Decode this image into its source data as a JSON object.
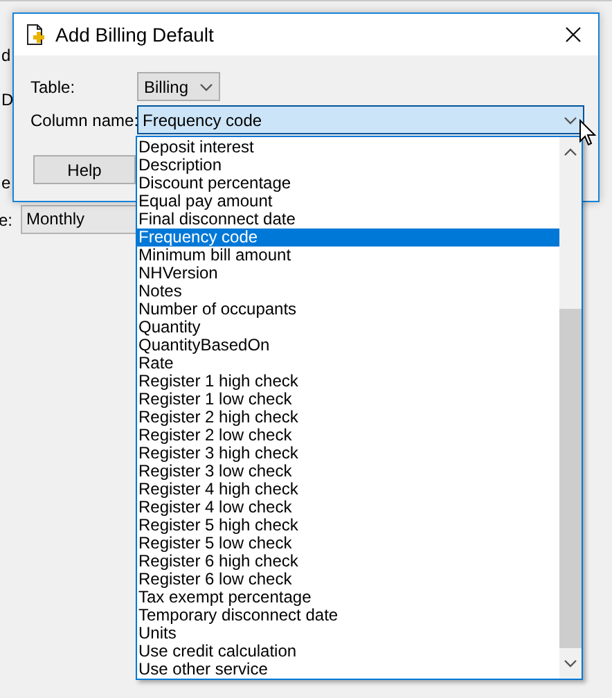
{
  "background": {
    "fragments": [
      "d",
      "D",
      "e"
    ],
    "field_label": "e:",
    "field_value": "Monthly"
  },
  "dialog": {
    "title": "Add Billing Default",
    "table_label": "Table:",
    "table_value": "Billing",
    "column_label": "Column name:",
    "column_value": "Frequency code",
    "help_button": "Help",
    "options": [
      {
        "label": "Deposit interest",
        "selected": false
      },
      {
        "label": "Description",
        "selected": false
      },
      {
        "label": "Discount percentage",
        "selected": false
      },
      {
        "label": "Equal pay amount",
        "selected": false
      },
      {
        "label": "Final disconnect date",
        "selected": false
      },
      {
        "label": "Frequency code",
        "selected": true
      },
      {
        "label": "Minimum bill amount",
        "selected": false
      },
      {
        "label": "NHVersion",
        "selected": false
      },
      {
        "label": "Notes",
        "selected": false
      },
      {
        "label": "Number of occupants",
        "selected": false
      },
      {
        "label": "Quantity",
        "selected": false
      },
      {
        "label": "QuantityBasedOn",
        "selected": false
      },
      {
        "label": "Rate",
        "selected": false
      },
      {
        "label": "Register 1 high check",
        "selected": false
      },
      {
        "label": "Register 1 low check",
        "selected": false
      },
      {
        "label": "Register 2 high check",
        "selected": false
      },
      {
        "label": "Register 2 low check",
        "selected": false
      },
      {
        "label": "Register 3 high check",
        "selected": false
      },
      {
        "label": "Register 3 low check",
        "selected": false
      },
      {
        "label": "Register 4 high check",
        "selected": false
      },
      {
        "label": "Register 4 low check",
        "selected": false
      },
      {
        "label": "Register 5 high check",
        "selected": false
      },
      {
        "label": "Register 5 low check",
        "selected": false
      },
      {
        "label": "Register 6 high check",
        "selected": false
      },
      {
        "label": "Register 6 low check",
        "selected": false
      },
      {
        "label": "Tax exempt percentage",
        "selected": false
      },
      {
        "label": "Temporary disconnect date",
        "selected": false
      },
      {
        "label": "Units",
        "selected": false
      },
      {
        "label": "Use credit calculation",
        "selected": false
      },
      {
        "label": "Use other service",
        "selected": false
      }
    ]
  }
}
